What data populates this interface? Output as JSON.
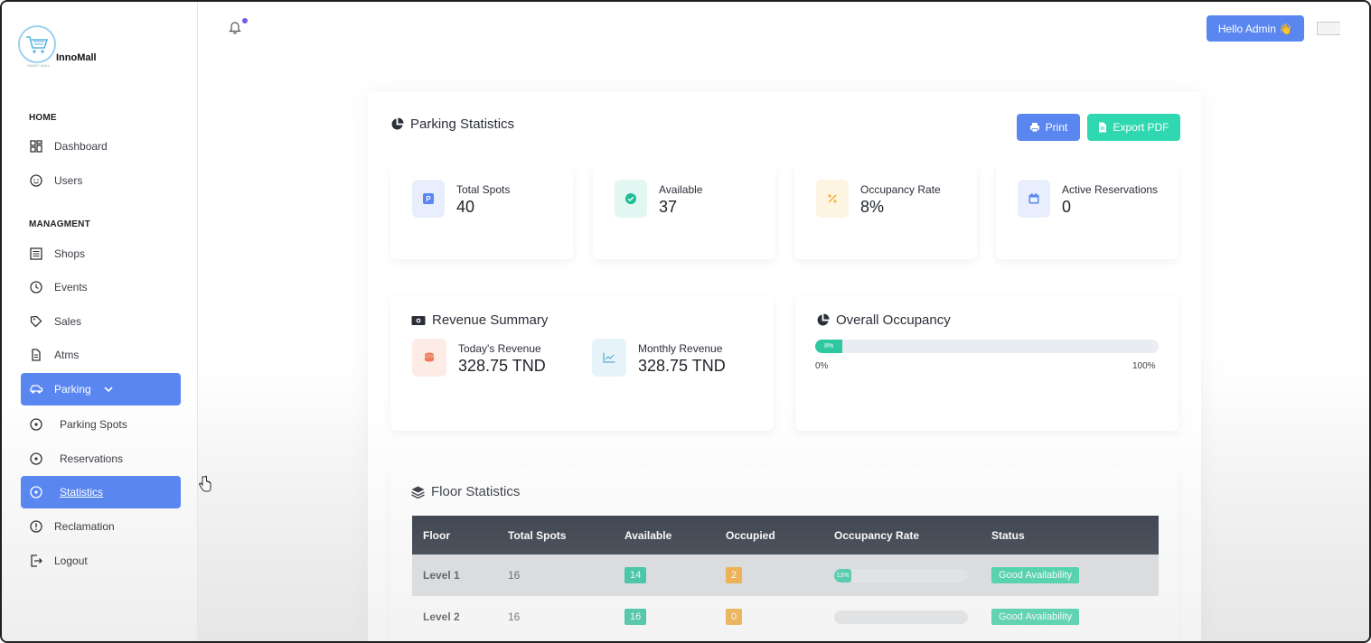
{
  "brand": {
    "name": "InnoMall",
    "tagline": "SMART MALL"
  },
  "sidebar": {
    "sections": {
      "home": "HOME",
      "management": "MANAGMENT"
    },
    "items": {
      "dashboard": "Dashboard",
      "users": "Users",
      "shops": "Shops",
      "events": "Events",
      "sales": "Sales",
      "atms": "Atms",
      "parking": "Parking",
      "parking_spots": "Parking Spots",
      "reservations": "Reservations",
      "statistics": "Statistics",
      "reclamation": "Reclamation",
      "logout": "Logout"
    }
  },
  "topbar": {
    "greeting": "Hello Admin 👋",
    "notification_dot": true
  },
  "page": {
    "title": "Parking Statistics",
    "print_label": "Print",
    "export_label": "Export PDF"
  },
  "stats": [
    {
      "label": "Total Spots",
      "value": "40",
      "icon": "parking-icon",
      "icon_color": "#5a86f0",
      "bg": "#e8eefc"
    },
    {
      "label": "Available",
      "value": "37",
      "icon": "check-circle-icon",
      "icon_color": "#1cbf97",
      "bg": "#e2f7f1"
    },
    {
      "label": "Occupancy Rate",
      "value": "8%",
      "icon": "percent-icon",
      "icon_color": "#f2b233",
      "bg": "#fdf4e2"
    },
    {
      "label": "Active Reservations",
      "value": "0",
      "icon": "calendar-icon",
      "icon_color": "#5a86f0",
      "bg": "#e8eefc"
    }
  ],
  "revenue": {
    "title": "Revenue Summary",
    "today_label": "Today's Revenue",
    "today_value": "328.75 TND",
    "monthly_label": "Monthly Revenue",
    "monthly_value": "328.75 TND"
  },
  "occupancy": {
    "title": "Overall Occupancy",
    "percent": 8,
    "percent_label": "8%",
    "min_label": "0%",
    "max_label": "100%"
  },
  "floors": {
    "title": "Floor Statistics",
    "headers": [
      "Floor",
      "Total Spots",
      "Available",
      "Occupied",
      "Occupancy Rate",
      "Status"
    ],
    "rows": [
      {
        "floor": "Level 1",
        "total": "16",
        "available": "14",
        "occupied": "2",
        "rate": 13,
        "rate_label": "13%",
        "status": "Good Availability"
      },
      {
        "floor": "Level 2",
        "total": "16",
        "available": "16",
        "occupied": "0",
        "rate": 0,
        "rate_label": "",
        "status": "Good Availability"
      }
    ]
  },
  "colors": {
    "primary": "#5a86f0",
    "accent": "#2fd8b0",
    "dark": "#242b38"
  }
}
